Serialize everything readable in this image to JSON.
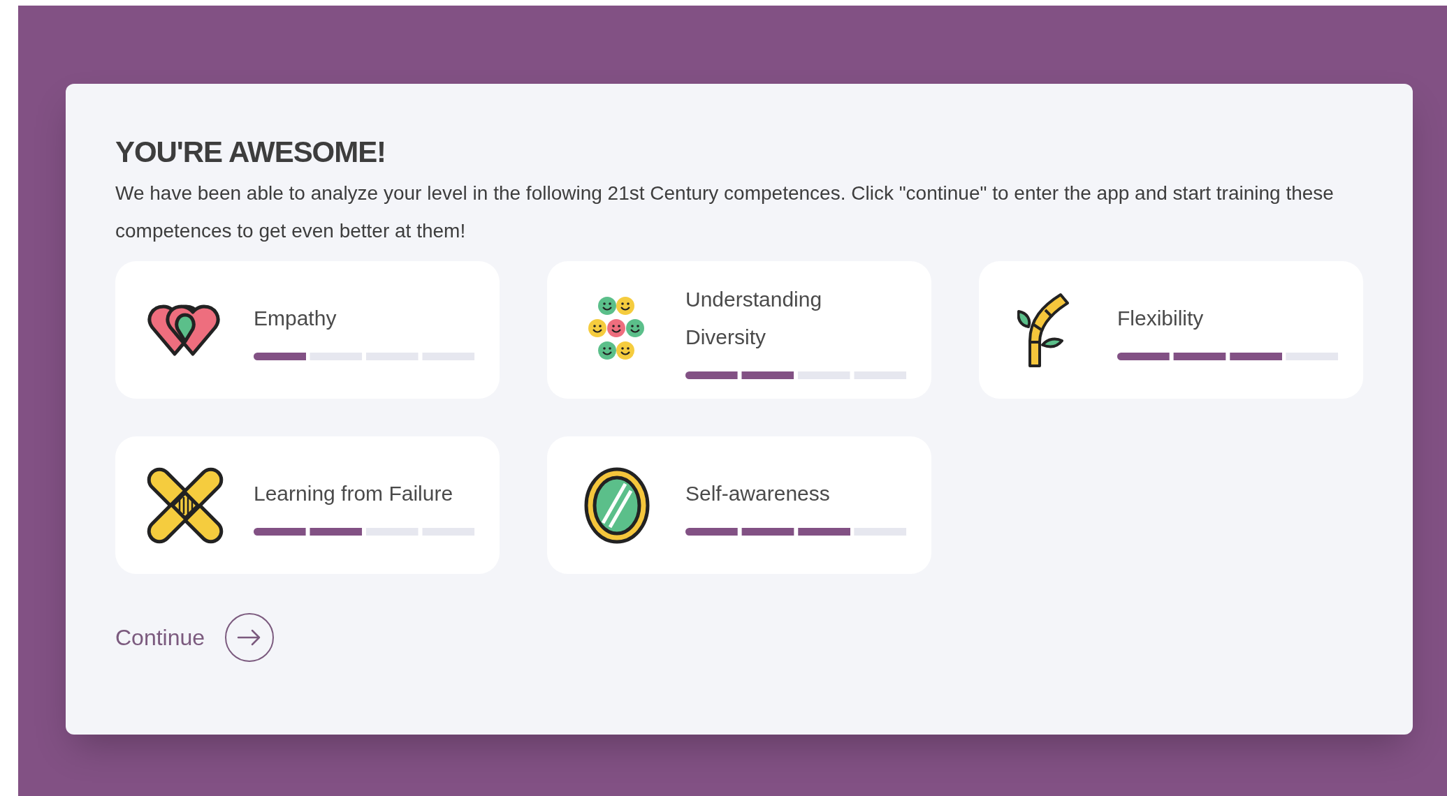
{
  "heading": "YOU'RE AWESOME!",
  "intro": "We have been able to analyze your level in the following 21st Century competences. Click \"continue\" to enter the app and start training these competences to get even better at them!",
  "competences": [
    {
      "name": "Empathy",
      "kind": "hearts",
      "level": 0.25
    },
    {
      "name": "Understanding Diversity",
      "kind": "faces",
      "level": 0.5
    },
    {
      "name": "Flexibility",
      "kind": "bamboo",
      "level": 0.75
    },
    {
      "name": "Learning from Failure",
      "kind": "bandage",
      "level": 0.5
    },
    {
      "name": "Self-awareness",
      "kind": "mirror",
      "level": 0.75
    }
  ],
  "continue_button": "Continue"
}
